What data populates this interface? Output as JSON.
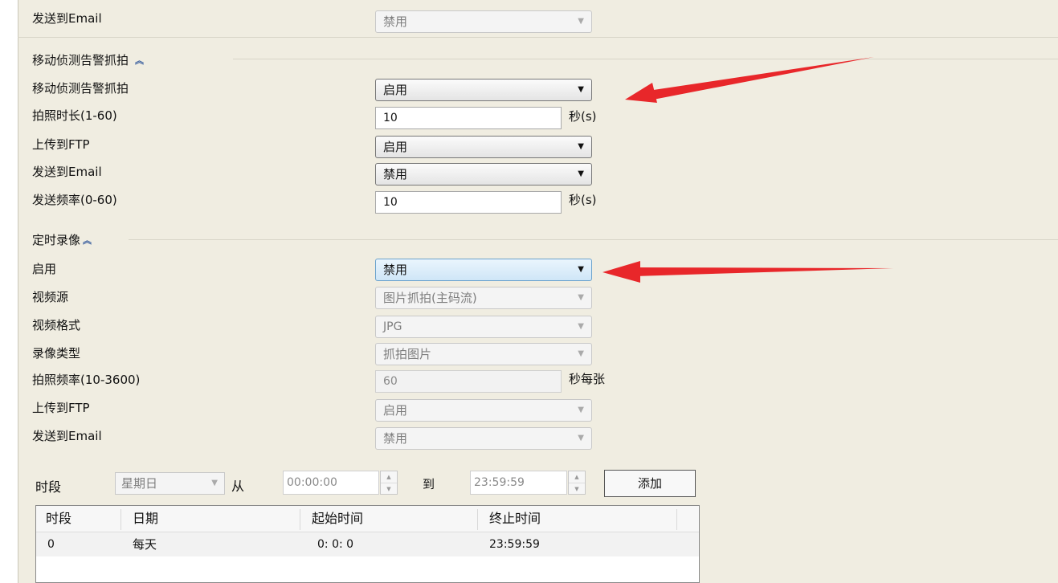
{
  "top_email_row": {
    "label": "发送到Email",
    "value": "禁用"
  },
  "motion_section": {
    "title": "移动侦测告警抓拍",
    "rows": [
      {
        "label": "移动侦测告警抓拍",
        "value": "启用"
      },
      {
        "label": "拍照时长(1-60)",
        "value": "10",
        "unit": "秒(s)"
      },
      {
        "label": "上传到FTP",
        "value": "启用"
      },
      {
        "label": "发送到Email",
        "value": "禁用"
      },
      {
        "label": "发送频率(0-60)",
        "value": "10",
        "unit": "秒(s)"
      }
    ]
  },
  "timer_section": {
    "title": "定时录像",
    "rows": [
      {
        "label": "启用",
        "value": "禁用"
      },
      {
        "label": "视频源",
        "value": "图片抓拍(主码流)"
      },
      {
        "label": "视频格式",
        "value": "JPG"
      },
      {
        "label": "录像类型",
        "value": "抓拍图片"
      },
      {
        "label": "拍照频率(10-3600)",
        "value": "60",
        "unit": "秒每张"
      },
      {
        "label": "上传到FTP",
        "value": "启用"
      },
      {
        "label": "发送到Email",
        "value": "禁用"
      }
    ]
  },
  "schedule": {
    "period_label": "时段",
    "day_value": "星期日",
    "from_label": "从",
    "start_time": "00:00:00",
    "to_label": "到",
    "end_time": "23:59:59",
    "add_button": "添加"
  },
  "table": {
    "headers": [
      "时段",
      "日期",
      "起始时间",
      "终止时间"
    ],
    "rows": [
      [
        "0",
        "每天",
        "0: 0: 0",
        "23:59:59"
      ]
    ]
  },
  "icons": {
    "collapse": "chevron-up-double-icon",
    "dropdown": "caret-down-icon",
    "spinner": "spinner-icon",
    "annotation": "red-arrow-icon"
  },
  "colors": {
    "panel_bg": "#f0ede1",
    "focus_blue": "#cfe6f7",
    "annotation_red": "#e8272a"
  }
}
